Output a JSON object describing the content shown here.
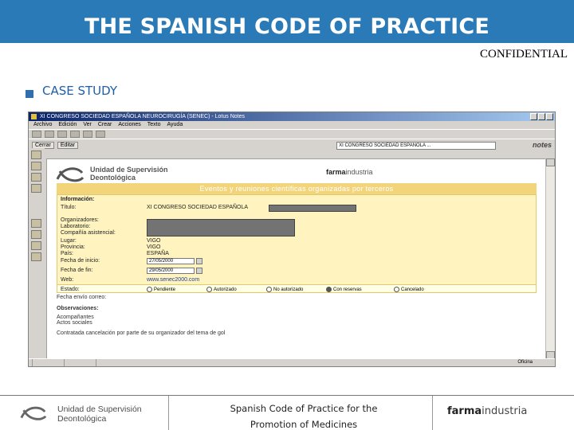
{
  "header": {
    "title": "THE SPANISH CODE OF PRACTICE"
  },
  "confidential": "CONFIDENTIAL",
  "section": {
    "label": "CASE STUDY"
  },
  "browser": {
    "window_title": "XI CONGRESO SOCIEDAD ESPAÑOLA NEUROCIRUGÍA (SENEC) - Lotus Notes",
    "menu": [
      "Archivo",
      "Edición",
      "Ver",
      "Crear",
      "Acciones",
      "Texto",
      "Ayuda"
    ],
    "action_buttons": [
      "Cerrar",
      "Editar"
    ],
    "address_value": "XI CONGRESO SOCIEDAD ESPAÑOLA ...",
    "notes_brand": "notes",
    "status_zone": "Oficina"
  },
  "page": {
    "logo_left": [
      "Unidad de Supervisión",
      "Deontológica"
    ],
    "logo_right_bold": "farma",
    "logo_right_rest": "industria",
    "banner": "Eventos y reuniones científicas organizadas por terceros",
    "form_section": "Información:",
    "fields": [
      {
        "label": "Título:",
        "value": "XI CONGRESO SOCIEDAD ESPAÑOLA"
      },
      {
        "label": "Organizadores:",
        "value": ""
      },
      {
        "label": "Laboratorio:",
        "value": ""
      },
      {
        "label": "Compañía asistencial:",
        "value": ""
      },
      {
        "label": "Lugar:",
        "value": "VIGO"
      },
      {
        "label": "Provincia:",
        "value": "VIGO"
      },
      {
        "label": "País:",
        "value": "ESPAÑA"
      },
      {
        "label": "Fecha de inicio:",
        "value": "27/05/2000"
      },
      {
        "label": "Fecha de fin:",
        "value": "29/05/2000"
      },
      {
        "label": "Web:",
        "value": "www.senec2000.com"
      },
      {
        "label": "Estado:",
        "value": ""
      },
      {
        "label": "Fecha envío correo:",
        "value": ""
      }
    ],
    "estado_options": [
      "Pendiente",
      "Autorizado",
      "No autorizado",
      "Con reservas",
      "Cancelado"
    ],
    "estado_selected_index": 3,
    "observaciones_label": "Observaciones:",
    "notes_lines": [
      "Acompañantes",
      "Actos sociales"
    ],
    "final_line": "Contratada cancelación por parte de su organizador del tema de gol"
  },
  "footer": {
    "logo_lines": [
      "Unidad de Supervisión",
      "Deontológica"
    ],
    "center_lines": [
      "Spanish Code of Practice for the",
      "Promotion of Medicines"
    ],
    "right_bold": "farma",
    "right_rest": "industria"
  }
}
